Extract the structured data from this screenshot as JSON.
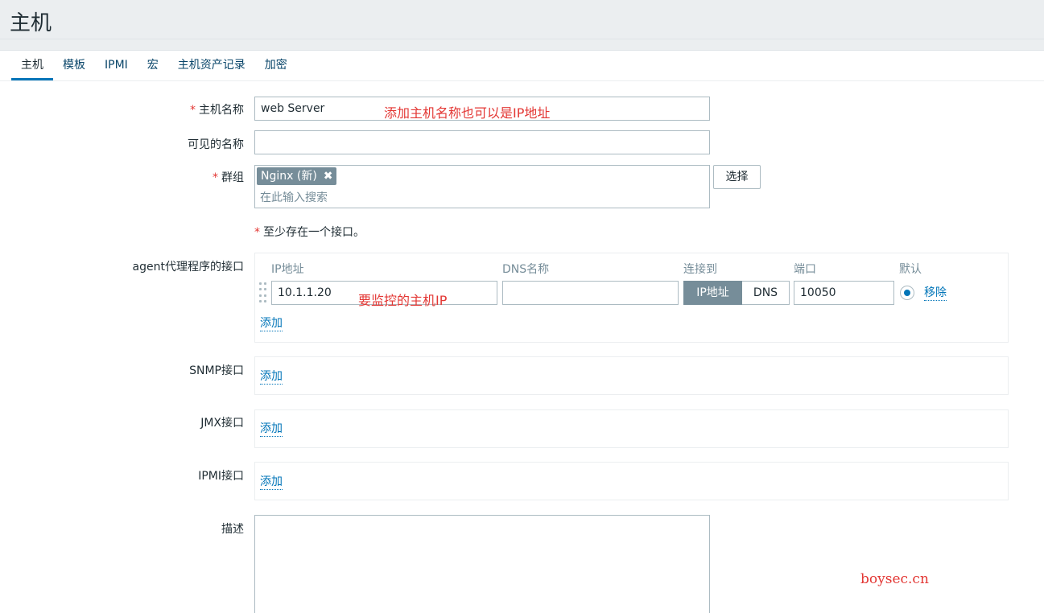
{
  "page": {
    "title": "主机"
  },
  "tabs": [
    {
      "label": "主机",
      "active": true
    },
    {
      "label": "模板"
    },
    {
      "label": "IPMI"
    },
    {
      "label": "宏"
    },
    {
      "label": "主机资产记录"
    },
    {
      "label": "加密"
    }
  ],
  "form": {
    "required_mark": "*",
    "host_name": {
      "label": "主机名称",
      "value": "web Server",
      "annotation": "添加主机名称也可以是IP地址"
    },
    "visible_name": {
      "label": "可见的名称",
      "value": ""
    },
    "groups": {
      "label": "群组",
      "chip": "Nginx (新)",
      "chip_remove": "✖",
      "placeholder": "在此输入搜索",
      "select_button": "选择"
    },
    "interface_note": "至少存在一个接口。",
    "agent": {
      "label": "agent代理程序的接口",
      "columns": {
        "ip": "IP地址",
        "dns": "DNS名称",
        "connect": "连接到",
        "port": "端口",
        "default": "默认"
      },
      "row": {
        "ip": "10.1.1.20",
        "dns": "",
        "connect_ip": "IP地址",
        "connect_dns": "DNS",
        "port": "10050",
        "remove": "移除"
      },
      "annotation": "要监控的主机IP",
      "add": "添加"
    },
    "snmp": {
      "label": "SNMP接口",
      "add": "添加"
    },
    "jmx": {
      "label": "JMX接口",
      "add": "添加"
    },
    "ipmi": {
      "label": "IPMI接口",
      "add": "添加"
    },
    "description": {
      "label": "描述",
      "value": ""
    }
  },
  "watermark": "boysec.cn",
  "colors": {
    "accent": "#0275b8",
    "annotation": "#e33734",
    "chip": "#768d99"
  }
}
